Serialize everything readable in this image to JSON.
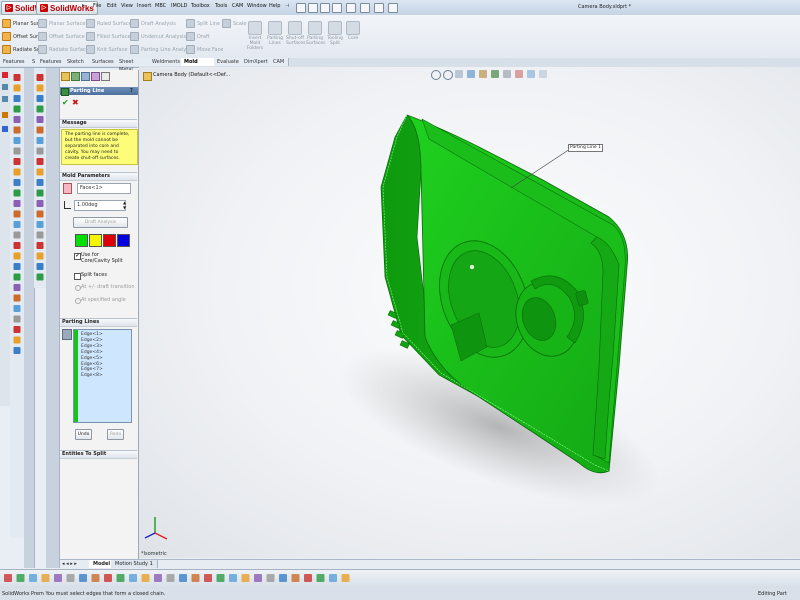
{
  "app": {
    "logo_small": "SolidW",
    "logo_main": "SolidWorks",
    "document_title": "Camera Body.sldprt *",
    "menu": [
      "File",
      "Edit",
      "View",
      "Insert",
      "MBC",
      "IMOLD",
      "Toolbox",
      "Tools",
      "CAM",
      "Window",
      "Help"
    ]
  },
  "commands": {
    "col1": [
      {
        "label": "Planar Surf",
        "active": true
      },
      {
        "label": "Offset Surf",
        "active": true
      },
      {
        "label": "Radiate Su",
        "active": true
      }
    ],
    "col2": [
      "Planar Surface",
      "Offset Surface",
      "Radiate Surface"
    ],
    "col3": [
      "Ruled Surface",
      "Filled Surface",
      "Knit Surface"
    ],
    "col4": [
      "Draft Analysis",
      "Undercut Analysis",
      "Parting Line Analysis"
    ],
    "col5": [
      "Split Line",
      "Draft",
      "Move Face"
    ],
    "col6": [
      "Scale"
    ],
    "large": [
      "Insert Mold Folders",
      "Parting Lines",
      "Shut-off Surfaces",
      "Parting Surfaces",
      "Tooling Split",
      "Core"
    ]
  },
  "tabs": [
    "Features",
    "S",
    "Features",
    "Sketch",
    "Surfaces",
    "Sheet Metal",
    "Weldments",
    "Mold Tools",
    "Evaluate",
    "DimXpert",
    "CAM"
  ],
  "active_tab": "Mold Tools",
  "property_manager": {
    "title": "Parting Line",
    "help": "?",
    "message_section": "Message",
    "message_text": "The parting line is complete, but the mold cannot be separated into core and cavity. You may need to create shut-off surfaces.",
    "mold_params_section": "Mold Parameters",
    "direction_value": "Face<1>",
    "angle_value": "1.00deg",
    "draft_analysis_button": "Draft Analysis",
    "colors": [
      "#00e000",
      "#f5f500",
      "#e00000",
      "#0000e0"
    ],
    "use_core_cavity_label": "Use for Core/Cavity Split",
    "use_core_cavity_checked": true,
    "split_faces_label": "Split faces",
    "split_faces_checked": false,
    "radio_1": "At +/- draft transition",
    "radio_2": "At specified angle",
    "parting_lines_section": "Parting Lines",
    "edges": [
      "Edge<1>",
      "Edge<2>",
      "Edge<3>",
      "Edge<4>",
      "Edge<5>",
      "Edge<6>",
      "Edge<7>",
      "Edge<8>"
    ],
    "undo_button": "Undo",
    "redo_button": "Redo",
    "entities_section": "Entities To Split"
  },
  "graphics": {
    "tree_root": "Camera Body  (Default<<Def...",
    "callout_label": "Parting Line 1",
    "view_orientation": "*Isometric",
    "model_color": "#19c419"
  },
  "bottom_tabs": [
    "Model",
    "Motion Study 1"
  ],
  "status": {
    "message": "SolidWorks Prem You must select edges that form a closed chain.",
    "mode": "Editing Part"
  }
}
